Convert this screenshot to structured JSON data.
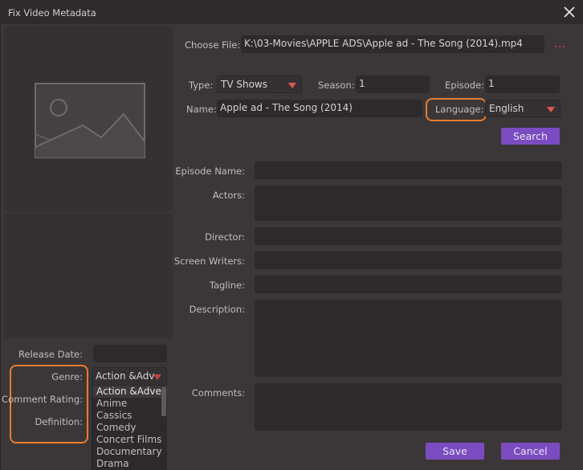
{
  "window": {
    "title": "Fix Video Metadata",
    "close_icon": "close-icon"
  },
  "file": {
    "label": "Choose File:",
    "value": "K:\\03-Movies\\APPLE ADS\\Apple ad - The Song (2014).mp4",
    "browse_icon": "more-dots-icon"
  },
  "type": {
    "label": "Type:",
    "value": "TV Shows"
  },
  "season": {
    "label": "Season:",
    "value": "1"
  },
  "episode": {
    "label": "Episode:",
    "value": "1"
  },
  "name": {
    "label": "Name:",
    "value": "Apple ad - The Song (2014)"
  },
  "language": {
    "label": "Language:",
    "value": "English"
  },
  "search_label": "Search",
  "details": {
    "episode_name": {
      "label": "Episode Name:",
      "value": ""
    },
    "actors": {
      "label": "Actors:",
      "value": ""
    },
    "director": {
      "label": "Director:",
      "value": ""
    },
    "screen_writers": {
      "label": "Screen Writers:",
      "value": ""
    },
    "tagline": {
      "label": "Tagline:",
      "value": ""
    },
    "description": {
      "label": "Description:",
      "value": ""
    },
    "comments": {
      "label": "Comments:",
      "value": ""
    }
  },
  "left": {
    "thumbnail_icon": "image-placeholder-icon",
    "release_date": {
      "label": "Release Date:",
      "value": ""
    },
    "genre": {
      "label": "Genre:",
      "value": "Action &Adv",
      "options": [
        "Action &Adver",
        "Anime",
        "Cassics",
        "Comedy",
        "Concert Films",
        "Documentary",
        "Drama"
      ],
      "selected_index": 0
    },
    "comment_rating": {
      "label": "Comment Rating:"
    },
    "definition": {
      "label": "Definition:"
    }
  },
  "buttons": {
    "save": "Save",
    "cancel": "Cancel"
  },
  "colors": {
    "accent": "#7b4cc1",
    "caret": "#e0584e",
    "highlight": "#e87d2e",
    "background": "#3b3738",
    "field": "#2e2a2b"
  }
}
